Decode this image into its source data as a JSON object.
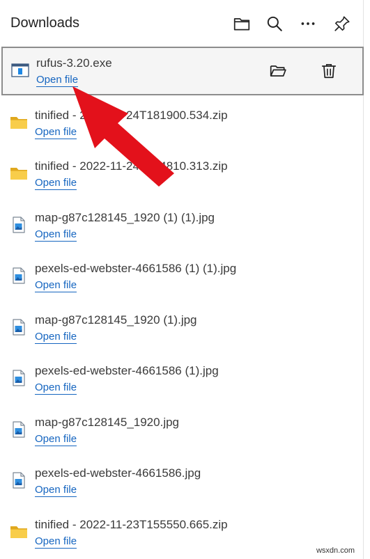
{
  "header": {
    "title": "Downloads",
    "icons": [
      "folder-icon",
      "search-icon",
      "more-icon",
      "pin-icon"
    ]
  },
  "open_file_label": "Open file",
  "items": [
    {
      "name": "rufus-3.20.exe",
      "type": "exe",
      "icon": "exe-file-icon"
    },
    {
      "name": "tinified - 2022-11-24T181900.534.zip",
      "type": "zip",
      "icon": "zip-folder-icon"
    },
    {
      "name": "tinified - 2022-11-24T154810.313.zip",
      "type": "zip",
      "icon": "zip-folder-icon"
    },
    {
      "name": "map-g87c128145_1920 (1) (1).jpg",
      "type": "jpg",
      "icon": "image-file-icon"
    },
    {
      "name": "pexels-ed-webster-4661586 (1) (1).jpg",
      "type": "jpg",
      "icon": "image-file-icon"
    },
    {
      "name": "map-g87c128145_1920 (1).jpg",
      "type": "jpg",
      "icon": "image-file-icon"
    },
    {
      "name": "pexels-ed-webster-4661586 (1).jpg",
      "type": "jpg",
      "icon": "image-file-icon"
    },
    {
      "name": "map-g87c128145_1920.jpg",
      "type": "jpg",
      "icon": "image-file-icon"
    },
    {
      "name": "pexels-ed-webster-4661586.jpg",
      "type": "jpg",
      "icon": "image-file-icon"
    },
    {
      "name": "tinified - 2022-11-23T155550.665.zip",
      "type": "zip",
      "icon": "zip-folder-icon"
    }
  ],
  "selected_actions": [
    "open-folder-icon",
    "delete-icon"
  ],
  "annotation": {
    "shape": "arrow",
    "color": "#e3111b",
    "points_to": "Open file"
  },
  "watermark": "wsxdn.com",
  "colors": {
    "link": "#1565c0",
    "arrow": "#e3111b",
    "selected_border": "#8c8c8c"
  }
}
